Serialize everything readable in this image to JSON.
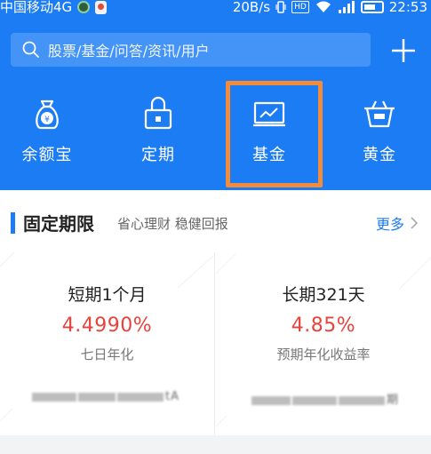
{
  "status_bar": {
    "carrier": "中国移动4G",
    "network_speed": "20B/s",
    "time": "22:53"
  },
  "search": {
    "placeholder": "股票/基金/问答/资讯/用户"
  },
  "quick_nav": [
    {
      "label": "余额宝",
      "icon": "money-bag-icon"
    },
    {
      "label": "定期",
      "icon": "lock-icon"
    },
    {
      "label": "基金",
      "icon": "chart-icon"
    },
    {
      "label": "黄金",
      "icon": "basket-icon"
    }
  ],
  "colors": {
    "brand_blue": "#1c7cf4",
    "highlight_orange": "#f28c3b",
    "rate_red": "#e8423c"
  },
  "section": {
    "title": "固定期限",
    "subtitle": "省心理财 稳健回报",
    "more_label": "更多"
  },
  "products": [
    {
      "name": "短期1个月",
      "rate": "4.4990%",
      "rate_desc": "七日年化",
      "note_tail": "tA"
    },
    {
      "name": "长期321天",
      "rate": "4.85%",
      "rate_desc": "预期年化收益率",
      "note_tail": "期"
    }
  ]
}
